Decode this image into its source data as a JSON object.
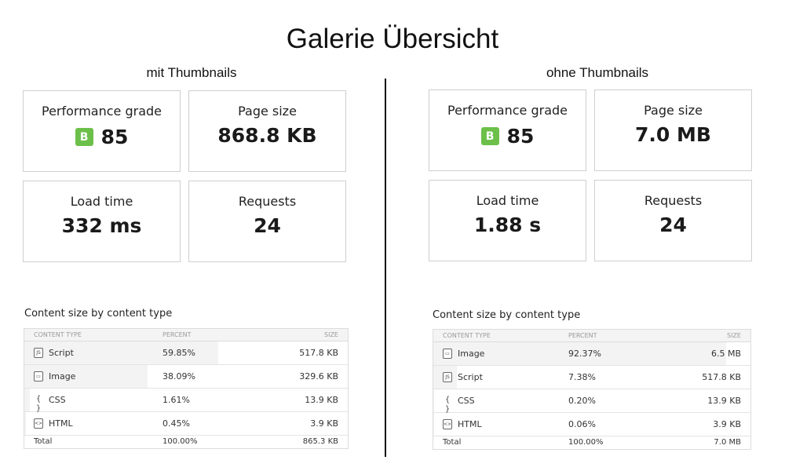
{
  "title": "Galerie Übersicht",
  "panels": [
    {
      "subtitle": "mit Thumbnails",
      "performance": {
        "label": "Performance grade",
        "grade": "B",
        "score": "85"
      },
      "page_size": {
        "label": "Page size",
        "value": "868.8 KB"
      },
      "load_time": {
        "label": "Load time",
        "value": "332 ms"
      },
      "requests": {
        "label": "Requests",
        "value": "24"
      },
      "content": {
        "title": "Content size by content type",
        "headers": [
          "CONTENT TYPE",
          "PERCENT",
          "SIZE"
        ],
        "rows": [
          {
            "icon": "js-file-icon",
            "name": "Script",
            "percent": "59.85%",
            "fraction": 0.5985,
            "size": "517.8 KB"
          },
          {
            "icon": "image-file-icon",
            "name": "Image",
            "percent": "38.09%",
            "fraction": 0.3809,
            "size": "329.6 KB"
          },
          {
            "icon": "css-braces-icon",
            "name": "CSS",
            "percent": "1.61%",
            "fraction": 0.0161,
            "size": "13.9 KB"
          },
          {
            "icon": "html-file-icon",
            "name": "HTML",
            "percent": "0.45%",
            "fraction": 0.0045,
            "size": "3.9 KB"
          }
        ],
        "total": {
          "name": "Total",
          "percent": "100.00%",
          "size": "865.3 KB"
        }
      }
    },
    {
      "subtitle": "ohne Thumbnails",
      "performance": {
        "label": "Performance grade",
        "grade": "B",
        "score": "85"
      },
      "page_size": {
        "label": "Page size",
        "value": "7.0 MB"
      },
      "load_time": {
        "label": "Load time",
        "value": "1.88 s"
      },
      "requests": {
        "label": "Requests",
        "value": "24"
      },
      "content": {
        "title": "Content size by content type",
        "headers": [
          "CONTENT TYPE",
          "PERCENT",
          "SIZE"
        ],
        "rows": [
          {
            "icon": "image-file-icon",
            "name": "Image",
            "percent": "92.37%",
            "fraction": 0.9237,
            "size": "6.5 MB"
          },
          {
            "icon": "js-file-icon",
            "name": "Script",
            "percent": "7.38%",
            "fraction": 0.0738,
            "size": "517.8 KB"
          },
          {
            "icon": "css-braces-icon",
            "name": "CSS",
            "percent": "0.20%",
            "fraction": 0.002,
            "size": "13.9 KB"
          },
          {
            "icon": "html-file-icon",
            "name": "HTML",
            "percent": "0.06%",
            "fraction": 0.0006,
            "size": "3.9 KB"
          }
        ],
        "total": {
          "name": "Total",
          "percent": "100.00%",
          "size": "7.0 MB"
        }
      }
    }
  ],
  "colors": {
    "grade_badge": "#6cc04a",
    "card_border": "#cfcfcf",
    "divider": "#111111",
    "bar_fill": "#f3f3f3"
  }
}
